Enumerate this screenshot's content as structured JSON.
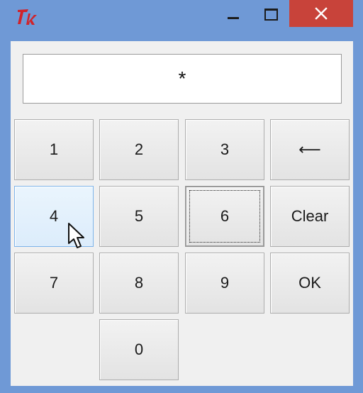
{
  "window": {
    "icon": "tk-feather-icon",
    "controls": [
      "minimize-icon",
      "maximize-icon",
      "close-icon"
    ]
  },
  "display": {
    "value": "*"
  },
  "keys": [
    {
      "label": "1"
    },
    {
      "label": "2"
    },
    {
      "label": "3"
    },
    {
      "label": "⟵"
    },
    {
      "label": "4"
    },
    {
      "label": "5"
    },
    {
      "label": "6"
    },
    {
      "label": "Clear"
    },
    {
      "label": "7"
    },
    {
      "label": "8"
    },
    {
      "label": "9"
    },
    {
      "label": "OK"
    },
    {
      "label": "0"
    }
  ],
  "colors": {
    "titlebar": "#6f99d6",
    "close": "#c8433a",
    "client": "#f0f0f0",
    "hover_key": "#dcecfb",
    "icon_red": "#d0232b"
  }
}
